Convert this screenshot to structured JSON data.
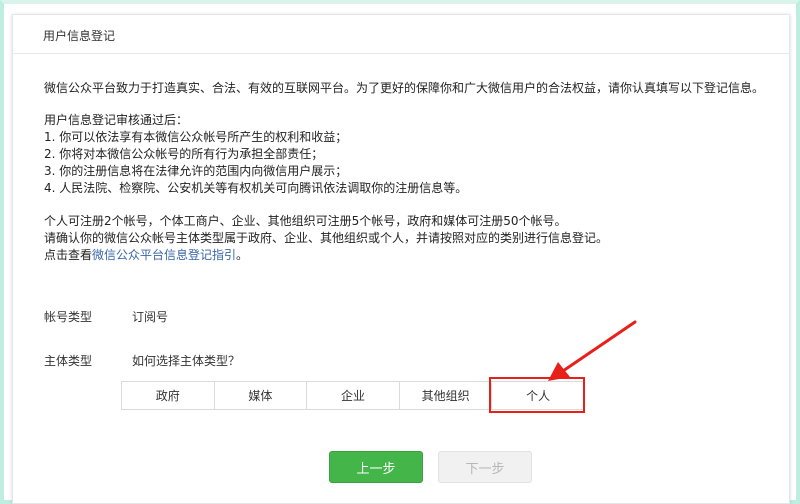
{
  "page": {
    "title": "用户信息登记"
  },
  "intro": {
    "text": "微信公众平台致力于打造真实、合法、有效的互联网平台。为了更好的保障你和广大微信用户的合法权益，请你认真填写以下登记信息。"
  },
  "review": {
    "heading": "用户信息登记审核通过后：",
    "items": [
      "1. 你可以依法享有本微信公众帐号所产生的权利和收益；",
      "2. 你将对本微信公众帐号的所有行为承担全部责任；",
      "3. 你的注册信息将在法律允许的范围内向微信用户展示；",
      "4. 人民法院、检察院、公安机关等有权机关可向腾讯依法调取你的注册信息等。"
    ]
  },
  "limits": {
    "line1": "个人可注册2个帐号，个体工商户、企业、其他组织可注册5个帐号，政府和媒体可注册50个帐号。",
    "line2": "请确认你的微信公众帐号主体类型属于政府、企业、其他组织或个人，并请按照对应的类别进行信息登记。",
    "guide_prefix": "点击查看",
    "guide_link": "微信公众平台信息登记指引",
    "guide_suffix": "。"
  },
  "form": {
    "account_type_label": "帐号类型",
    "account_type_value": "订阅号",
    "entity_type_label": "主体类型",
    "entity_help_link": "如何选择主体类型？",
    "entity_options": [
      "政府",
      "媒体",
      "企业",
      "其他组织",
      "个人"
    ],
    "highlighted_option": "个人"
  },
  "buttons": {
    "prev": "上一步",
    "next": "下一步"
  },
  "annotation": {
    "color": "#e8201a"
  }
}
